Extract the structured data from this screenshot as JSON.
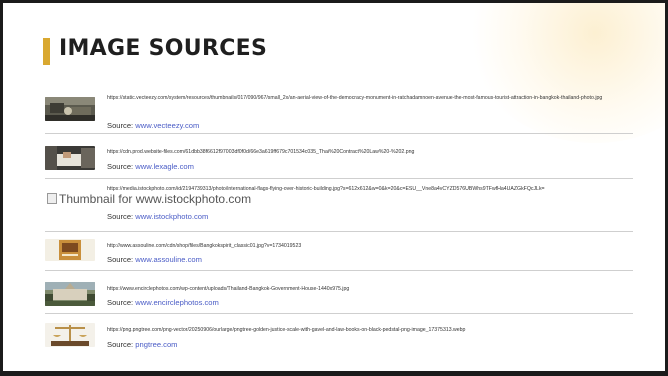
{
  "title": "IMAGE SOURCES",
  "source_prefix": "Source:",
  "accent_color": "#d9a830",
  "link_color": "#4a5cc6",
  "items": [
    {
      "url": "https://static.vecteezy.com/system/resources/thumbnails/017/090/967/small_2x/an-aerial-view-of-the-democracy-monument-in-ratchadamnoen-avenue-the-most-famous-tourist-attraction-in-bangkok-thailand-photo.jpg",
      "source": "www.vecteezy.com",
      "thumb": "aerial-monument-photo"
    },
    {
      "url": "https://cdn.prod.website-files.com/61dbb38f6612f97003df0f0d/66e3a619ff679c701534c035_Thai%20Contract%20Law%20-%202.png",
      "source": "www.lexagle.com",
      "thumb": "contract-signing-photo"
    },
    {
      "url": "https://media.istockphoto.com/id/2194739313/photo/international-flags-flying-over-historic-building.jpg?s=612x612&w=0&k=20&c=ESU__Vne8a4vCYZD576UBWhs9TFwfHa4UAZGkFQcJLk=",
      "source": "www.istockphoto.com",
      "thumb": "broken-image",
      "alt_text": "Thumbnail for www.istockphoto.com"
    },
    {
      "url": "http://www.assouline.com/cdn/shop/files/Bangkokspirit_classic01.jpg?v=1734019523",
      "source": "www.assouline.com",
      "thumb": "book-cover-photo"
    },
    {
      "url": "https://www.encirclephotos.com/wp-content/uploads/Thailand-Bangkok-Government-House-1440x975.jpg",
      "source": "www.encirclephotos.com",
      "thumb": "government-house-photo"
    },
    {
      "url": "https://png.pngtree.com/png-vector/20250906/ourlarge/pngtree-golden-justice-scale-with-gavel-and-law-books-on-black-pedstal-png-image_17375313.webp",
      "source": "pngtree.com",
      "thumb": "justice-scale-photo"
    }
  ]
}
